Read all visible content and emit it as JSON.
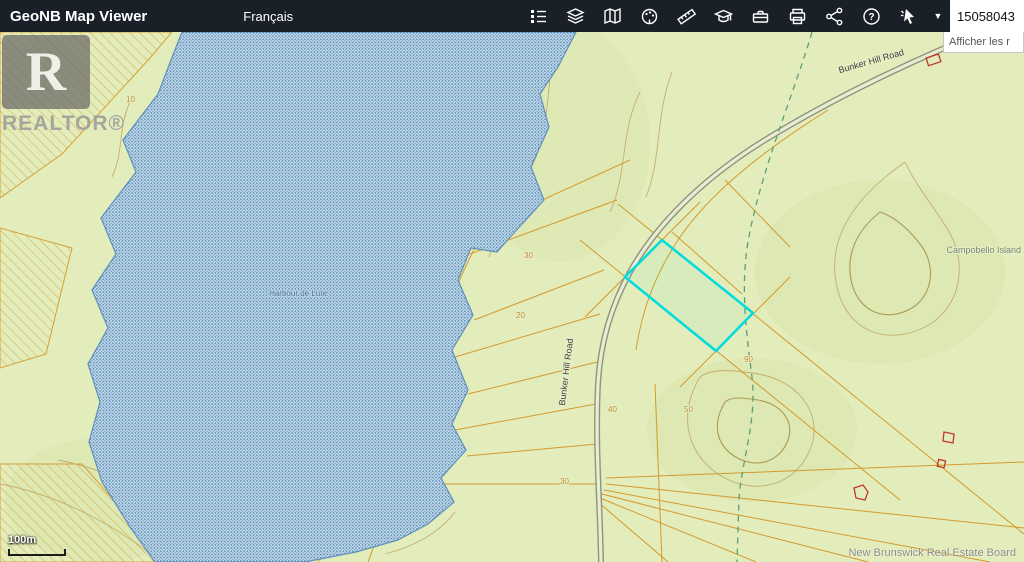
{
  "header": {
    "title": "GeoNB Map Viewer",
    "language_link": "Français",
    "search_value": "15058043",
    "suggestion_text": "Afficher les r",
    "help_glyph": "?",
    "caret_glyph": "▼",
    "toolbar_icons": [
      {
        "name": "legend-list-icon",
        "label": "Legend"
      },
      {
        "name": "layers-icon",
        "label": "Layers"
      },
      {
        "name": "basemap-icon",
        "label": "Basemap"
      },
      {
        "name": "draw-icon",
        "label": "Draw"
      },
      {
        "name": "measure-icon",
        "label": "Measure"
      },
      {
        "name": "graduation-cap-icon",
        "label": "Education"
      },
      {
        "name": "toolbox-icon",
        "label": "Tools"
      },
      {
        "name": "printer-icon",
        "label": "Print"
      },
      {
        "name": "share-icon",
        "label": "Share"
      },
      {
        "name": "help-icon",
        "label": "Help"
      },
      {
        "name": "identify-pointer-icon",
        "label": "Identify"
      }
    ]
  },
  "map": {
    "watermark_letter": "R",
    "watermark_text": "REALTOR®",
    "water_label": "Harbour de Lute",
    "island_label": "Campobello Island",
    "road_label_upper": "Bunker Hill Road",
    "road_label_mid": "Bunker Hill Road",
    "scale_label": "100m",
    "attribution": "New Brunswick Real Estate Board",
    "contour_labels": [
      {
        "text": "10"
      },
      {
        "text": "30"
      },
      {
        "text": "20"
      },
      {
        "text": "40"
      },
      {
        "text": "50"
      },
      {
        "text": "90"
      },
      {
        "text": "30"
      }
    ],
    "colors": {
      "selection": "#00dcdc",
      "cadastral": "#d49a2c",
      "land": "#e3ecbb",
      "water_dot": "#4d86b3",
      "building": "#c03a2b"
    }
  }
}
